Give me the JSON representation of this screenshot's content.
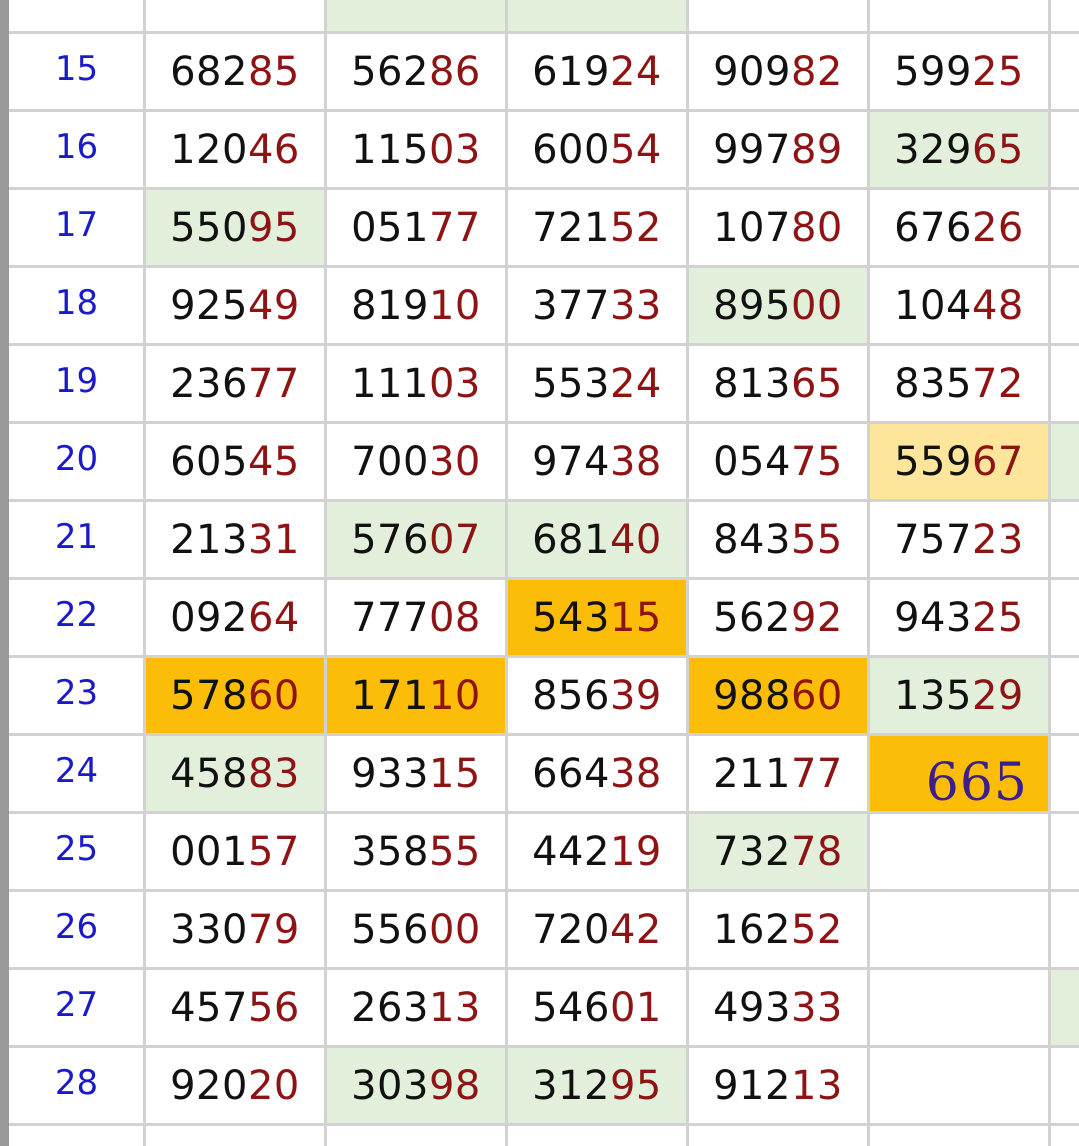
{
  "rows": [
    {
      "num": "15",
      "cells": [
        {
          "a": "682",
          "b": "85",
          "bg": ""
        },
        {
          "a": "562",
          "b": "86",
          "bg": ""
        },
        {
          "a": "619",
          "b": "24",
          "bg": ""
        },
        {
          "a": "909",
          "b": "82",
          "bg": ""
        },
        {
          "a": "599",
          "b": "25",
          "bg": ""
        }
      ]
    },
    {
      "num": "16",
      "cells": [
        {
          "a": "120",
          "b": "46",
          "bg": ""
        },
        {
          "a": "115",
          "b": "03",
          "bg": ""
        },
        {
          "a": "600",
          "b": "54",
          "bg": ""
        },
        {
          "a": "997",
          "b": "89",
          "bg": ""
        },
        {
          "a": "329",
          "b": "65",
          "bg": "green"
        }
      ]
    },
    {
      "num": "17",
      "cells": [
        {
          "a": "550",
          "b": "95",
          "bg": "green"
        },
        {
          "a": "051",
          "b": "77",
          "bg": ""
        },
        {
          "a": "721",
          "b": "52",
          "bg": ""
        },
        {
          "a": "107",
          "b": "80",
          "bg": ""
        },
        {
          "a": "676",
          "b": "26",
          "bg": ""
        }
      ]
    },
    {
      "num": "18",
      "cells": [
        {
          "a": "925",
          "b": "49",
          "bg": ""
        },
        {
          "a": "819",
          "b": "10",
          "bg": ""
        },
        {
          "a": "377",
          "b": "33",
          "bg": ""
        },
        {
          "a": "895",
          "b": "00",
          "bg": "green"
        },
        {
          "a": "104",
          "b": "48",
          "bg": ""
        }
      ]
    },
    {
      "num": "19",
      "cells": [
        {
          "a": "236",
          "b": "77",
          "bg": ""
        },
        {
          "a": "111",
          "b": "03",
          "bg": ""
        },
        {
          "a": "553",
          "b": "24",
          "bg": ""
        },
        {
          "a": "813",
          "b": "65",
          "bg": ""
        },
        {
          "a": "835",
          "b": "72",
          "bg": ""
        }
      ]
    },
    {
      "num": "20",
      "cells": [
        {
          "a": "605",
          "b": "45",
          "bg": ""
        },
        {
          "a": "700",
          "b": "30",
          "bg": ""
        },
        {
          "a": "974",
          "b": "38",
          "bg": ""
        },
        {
          "a": "054",
          "b": "75",
          "bg": ""
        },
        {
          "a": "559",
          "b": "67",
          "bg": "lightorange"
        }
      ],
      "edge": true
    },
    {
      "num": "21",
      "cells": [
        {
          "a": "213",
          "b": "31",
          "bg": ""
        },
        {
          "a": "576",
          "b": "07",
          "bg": "green"
        },
        {
          "a": "681",
          "b": "40",
          "bg": "green"
        },
        {
          "a": "843",
          "b": "55",
          "bg": ""
        },
        {
          "a": "757",
          "b": "23",
          "bg": ""
        }
      ]
    },
    {
      "num": "22",
      "cells": [
        {
          "a": "092",
          "b": "64",
          "bg": ""
        },
        {
          "a": "777",
          "b": "08",
          "bg": ""
        },
        {
          "a": "543",
          "b": "15",
          "bg": "orange"
        },
        {
          "a": "562",
          "b": "92",
          "bg": ""
        },
        {
          "a": "943",
          "b": "25",
          "bg": ""
        }
      ]
    },
    {
      "num": "23",
      "cells": [
        {
          "a": "578",
          "b": "60",
          "bg": "orange"
        },
        {
          "a": "171",
          "b": "10",
          "bg": "orange"
        },
        {
          "a": "856",
          "b": "39",
          "bg": ""
        },
        {
          "a": "988",
          "b": "60",
          "bg": "orange"
        },
        {
          "a": "135",
          "b": "29",
          "bg": "green"
        }
      ]
    },
    {
      "num": "24",
      "cells": [
        {
          "a": "458",
          "b": "83",
          "bg": "green"
        },
        {
          "a": "933",
          "b": "15",
          "bg": ""
        },
        {
          "a": "664",
          "b": "38",
          "bg": ""
        },
        {
          "a": "211",
          "b": "77",
          "bg": ""
        },
        {
          "hand": "665",
          "bg": "orange"
        }
      ]
    },
    {
      "num": "25",
      "cells": [
        {
          "a": "001",
          "b": "57",
          "bg": ""
        },
        {
          "a": "358",
          "b": "55",
          "bg": ""
        },
        {
          "a": "442",
          "b": "19",
          "bg": ""
        },
        {
          "a": "732",
          "b": "78",
          "bg": "green"
        },
        {
          "a": "",
          "b": "",
          "bg": ""
        }
      ]
    },
    {
      "num": "26",
      "cells": [
        {
          "a": "330",
          "b": "79",
          "bg": ""
        },
        {
          "a": "556",
          "b": "00",
          "bg": ""
        },
        {
          "a": "720",
          "b": "42",
          "bg": ""
        },
        {
          "a": "162",
          "b": "52",
          "bg": ""
        },
        {
          "a": "",
          "b": "",
          "bg": ""
        }
      ]
    },
    {
      "num": "27",
      "cells": [
        {
          "a": "457",
          "b": "56",
          "bg": ""
        },
        {
          "a": "263",
          "b": "13",
          "bg": ""
        },
        {
          "a": "546",
          "b": "01",
          "bg": ""
        },
        {
          "a": "493",
          "b": "33",
          "bg": ""
        },
        {
          "a": "",
          "b": "",
          "bg": ""
        }
      ],
      "edge": true
    },
    {
      "num": "28",
      "cells": [
        {
          "a": "920",
          "b": "20",
          "bg": ""
        },
        {
          "a": "303",
          "b": "98",
          "bg": "green"
        },
        {
          "a": "312",
          "b": "95",
          "bg": "green"
        },
        {
          "a": "912",
          "b": "13",
          "bg": ""
        },
        {
          "a": "",
          "b": "",
          "bg": ""
        }
      ]
    }
  ]
}
